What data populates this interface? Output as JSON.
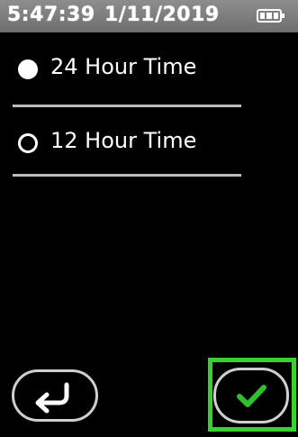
{
  "status_bar": {
    "time": "5:47:39",
    "date": "1/11/2019",
    "battery_icon": "battery-full-icon"
  },
  "options": [
    {
      "label": "24 Hour Time",
      "selected": true
    },
    {
      "label": "12 Hour Time",
      "selected": false
    }
  ],
  "buttons": {
    "back_icon": "return-arrow-icon",
    "confirm_icon": "checkmark-icon"
  },
  "colors": {
    "highlight": "#39d12f",
    "checkmark": "#2fbf2f",
    "header": "#7d7d7d"
  }
}
